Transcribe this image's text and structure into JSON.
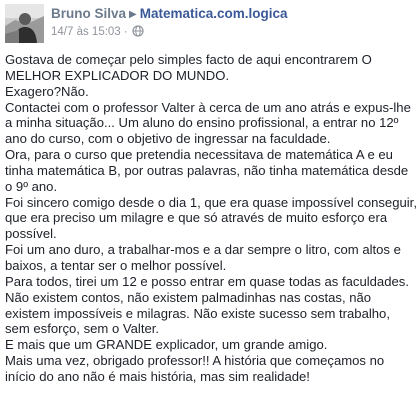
{
  "post": {
    "author": "Bruno Silva",
    "group": "Matematica.com.logica",
    "timestamp": "14/7 às 15:03",
    "separator": "·",
    "arrow_icon": "triangle-right-icon",
    "privacy_icon": "globe-icon",
    "paragraphs": [
      "Gostava de começar pelo simples facto de aqui encontrarem O MELHOR EXPLICADOR DO MUNDO.",
      "Exagero?Não.",
      "Contactei com o professor Valter à cerca de um ano atrás e expus-lhe a minha situação... Um aluno do ensino profissional, a entrar no 12º ano do curso, com o objetivo de ingressar na faculdade.",
      "Ora, para o curso que pretendia necessitava de matemática A e eu tinha matemática B, por outras palavras, não tinha matemática desde o 9º ano.",
      "Foi sincero comigo desde o dia 1, que era quase impossível conseguir, que era preciso um milagre e que só através de muito esforço era possível.",
      "Foi um ano duro, a trabalhar-mos e a dar sempre o litro, com altos e baixos, a tentar ser o melhor possível.",
      "Para todos, tirei um 12 e posso entrar em quase todas as faculdades.",
      "Não existem contos, não existem palmadinhas nas costas, não existem impossíveis e milagras. Não existe sucesso sem trabalho, sem esforço, sem o Valter.",
      "E mais que um GRANDE explicador, um grande amigo.",
      "Mais uma vez, obrigado professor!! A história que começamos no início do ano não é mais história, mas sim realidade!"
    ]
  }
}
